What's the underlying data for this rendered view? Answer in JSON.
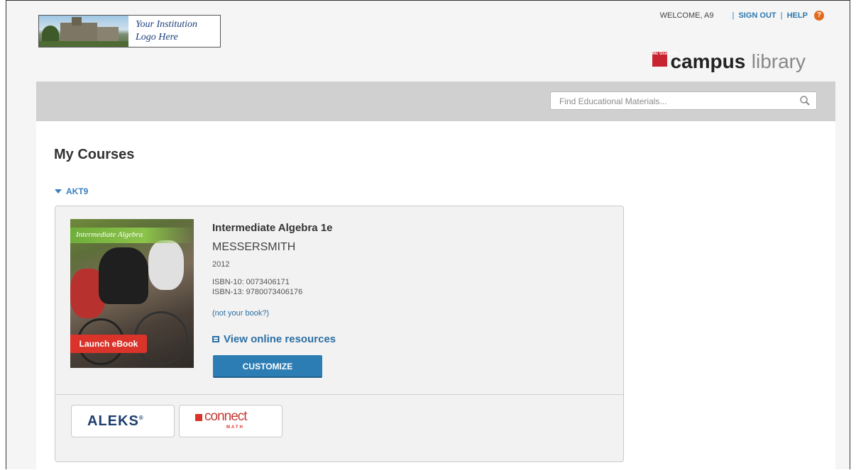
{
  "institution": {
    "logo_text_line1": "Your Institution",
    "logo_text_line2": "Logo Here"
  },
  "header": {
    "welcome": "WELCOME, A9",
    "sign_out": "SIGN OUT",
    "help": "HELP",
    "separator": "|",
    "help_icon": "?",
    "brand_mark": "Mc Graw Hill",
    "brand_campus": "campus",
    "brand_library": "library"
  },
  "search": {
    "placeholder": "Find Educational Materials...",
    "value": ""
  },
  "main": {
    "title": "My Courses",
    "course_code": "AKT9",
    "book": {
      "cover_title": "Intermediate Algebra",
      "title": "Intermediate Algebra 1e",
      "author": "MESSERSMITH",
      "year": "2012",
      "isbn10": "ISBN-10: 0073406171",
      "isbn13": "ISBN-13: 9780073406176",
      "not_your_book": "(not your book?)",
      "launch_label": "Launch eBook",
      "online_resources_label": "View online resources",
      "customize_label": "CUSTOMIZE"
    },
    "partners": {
      "aleks_label": "ALEKS",
      "aleks_reg": "®",
      "connect_label": "connect",
      "connect_sub": "MATH"
    }
  },
  "colors": {
    "accent_blue": "#2c7db4",
    "launch_red": "#d9332a",
    "link_blue": "#2c6fa3",
    "help_orange": "#e06b1c"
  },
  "icons": {
    "search": "search-icon",
    "help": "help-icon",
    "caret": "caret-down-icon",
    "resources": "resources-icon"
  }
}
